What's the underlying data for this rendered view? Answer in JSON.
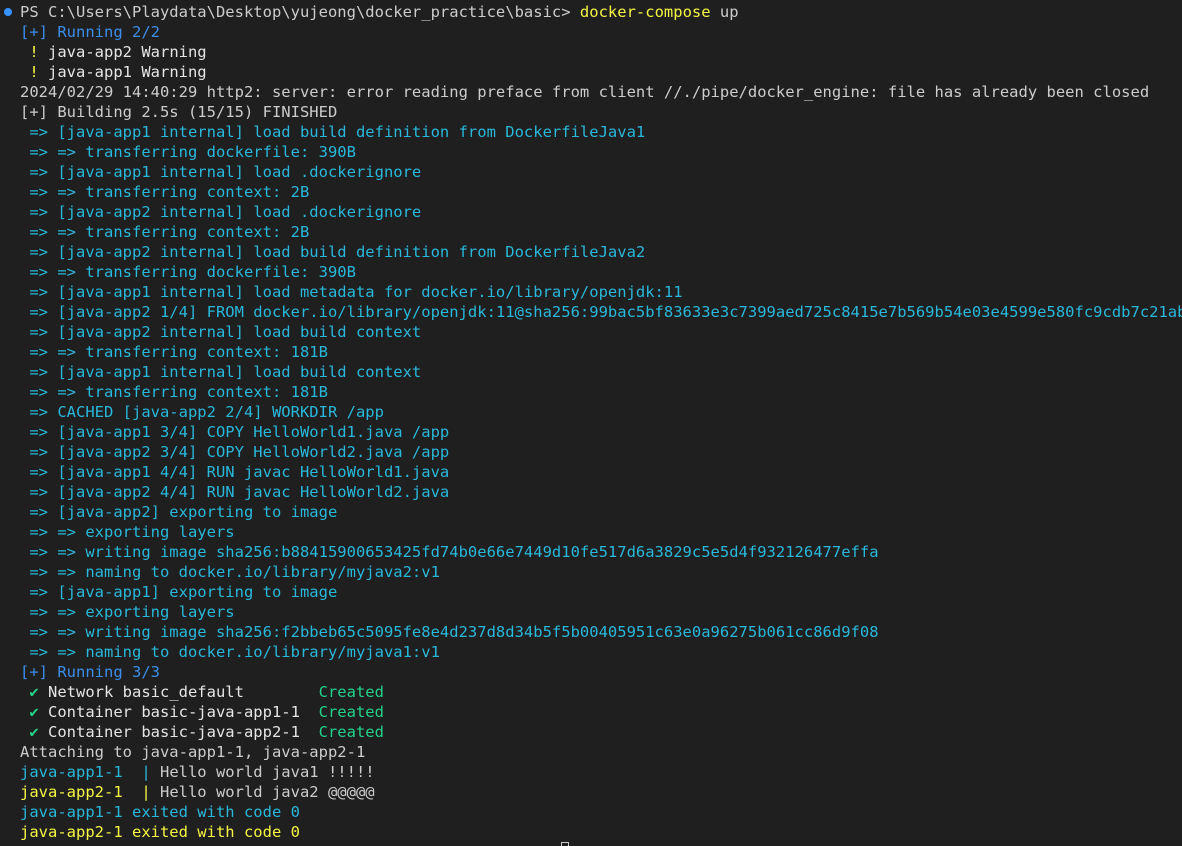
{
  "terminal": {
    "lines": [
      {
        "prompt": true,
        "segments": [
          {
            "text": "PS C:\\Users\\Playdata\\Desktop\\yujeong\\docker_practice\\basic> ",
            "color": "white"
          },
          {
            "text": "docker-compose",
            "color": "yellow"
          },
          {
            "text": " up",
            "color": "white"
          }
        ]
      },
      {
        "segments": [
          {
            "text": "[+] Running 2/2",
            "color": "blue"
          }
        ]
      },
      {
        "segments": [
          {
            "text": " ! ",
            "color": "warn"
          },
          {
            "text": "java-app2 Warning",
            "color": "bright-white"
          }
        ]
      },
      {
        "segments": [
          {
            "text": " ! ",
            "color": "warn"
          },
          {
            "text": "java-app1 Warning",
            "color": "bright-white"
          }
        ]
      },
      {
        "segments": [
          {
            "text": "2024/02/29 14:40:29 http2: server: error reading preface from client //./pipe/docker_engine: file has already been closed",
            "color": "white"
          }
        ]
      },
      {
        "segments": [
          {
            "text": "[+] Building 2.5s (15/15) FINISHED",
            "color": "white"
          }
        ]
      },
      {
        "segments": [
          {
            "text": " => [java-app1 internal] load build definition from DockerfileJava1",
            "color": "cyan"
          }
        ]
      },
      {
        "segments": [
          {
            "text": " => => transferring dockerfile: 390B",
            "color": "cyan"
          }
        ]
      },
      {
        "segments": [
          {
            "text": " => [java-app1 internal] load .dockerignore",
            "color": "cyan"
          }
        ]
      },
      {
        "segments": [
          {
            "text": " => => transferring context: 2B",
            "color": "cyan"
          }
        ]
      },
      {
        "segments": [
          {
            "text": " => [java-app2 internal] load .dockerignore",
            "color": "cyan"
          }
        ]
      },
      {
        "segments": [
          {
            "text": " => => transferring context: 2B",
            "color": "cyan"
          }
        ]
      },
      {
        "segments": [
          {
            "text": " => [java-app2 internal] load build definition from DockerfileJava2",
            "color": "cyan"
          }
        ]
      },
      {
        "segments": [
          {
            "text": " => => transferring dockerfile: 390B",
            "color": "cyan"
          }
        ]
      },
      {
        "segments": [
          {
            "text": " => [java-app1 internal] load metadata for docker.io/library/openjdk:11",
            "color": "cyan"
          }
        ]
      },
      {
        "segments": [
          {
            "text": " => [java-app2 1/4] FROM docker.io/library/openjdk:11@sha256:99bac5bf83633e3c7399aed725c8415e7b569b54e03e4599e580fc9cdb7c21ab",
            "color": "cyan"
          }
        ]
      },
      {
        "segments": [
          {
            "text": " => [java-app2 internal] load build context",
            "color": "cyan"
          }
        ]
      },
      {
        "segments": [
          {
            "text": " => => transferring context: 181B",
            "color": "cyan"
          }
        ]
      },
      {
        "segments": [
          {
            "text": " => [java-app1 internal] load build context",
            "color": "cyan"
          }
        ]
      },
      {
        "segments": [
          {
            "text": " => => transferring context: 181B",
            "color": "cyan"
          }
        ]
      },
      {
        "segments": [
          {
            "text": " => CACHED [java-app2 2/4] WORKDIR /app",
            "color": "cyan"
          }
        ]
      },
      {
        "segments": [
          {
            "text": " => [java-app1 3/4] COPY HelloWorld1.java /app",
            "color": "cyan"
          }
        ]
      },
      {
        "segments": [
          {
            "text": " => [java-app2 3/4] COPY HelloWorld2.java /app",
            "color": "cyan"
          }
        ]
      },
      {
        "segments": [
          {
            "text": " => [java-app1 4/4] RUN javac HelloWorld1.java",
            "color": "cyan"
          }
        ]
      },
      {
        "segments": [
          {
            "text": " => [java-app2 4/4] RUN javac HelloWorld2.java",
            "color": "cyan"
          }
        ]
      },
      {
        "segments": [
          {
            "text": " => [java-app2] exporting to image",
            "color": "cyan"
          }
        ]
      },
      {
        "segments": [
          {
            "text": " => => exporting layers",
            "color": "cyan"
          }
        ]
      },
      {
        "segments": [
          {
            "text": " => => writing image sha256:b88415900653425fd74b0e66e7449d10fe517d6a3829c5e5d4f932126477effa",
            "color": "cyan"
          }
        ]
      },
      {
        "segments": [
          {
            "text": " => => naming to docker.io/library/myjava2:v1",
            "color": "cyan"
          }
        ]
      },
      {
        "segments": [
          {
            "text": " => [java-app1] exporting to image",
            "color": "cyan"
          }
        ]
      },
      {
        "segments": [
          {
            "text": " => => exporting layers",
            "color": "cyan"
          }
        ]
      },
      {
        "segments": [
          {
            "text": " => => writing image sha256:f2bbeb65c5095fe8e4d237d8d34b5f5b00405951c63e0a96275b061cc86d9f08",
            "color": "cyan"
          }
        ]
      },
      {
        "segments": [
          {
            "text": " => => naming to docker.io/library/myjava1:v1",
            "color": "cyan"
          }
        ]
      },
      {
        "segments": [
          {
            "text": "[+] Running 3/3",
            "color": "blue"
          }
        ]
      },
      {
        "segments": [
          {
            "text": " ✔ ",
            "color": "check"
          },
          {
            "text": "Network basic_default        ",
            "color": "bright-white"
          },
          {
            "text": "Created",
            "color": "green"
          }
        ]
      },
      {
        "segments": [
          {
            "text": " ✔ ",
            "color": "check"
          },
          {
            "text": "Container basic-java-app1-1  ",
            "color": "bright-white"
          },
          {
            "text": "Created",
            "color": "green"
          }
        ]
      },
      {
        "segments": [
          {
            "text": " ✔ ",
            "color": "check"
          },
          {
            "text": "Container basic-java-app2-1  ",
            "color": "bright-white"
          },
          {
            "text": "Created",
            "color": "green"
          }
        ]
      },
      {
        "segments": [
          {
            "text": "Attaching to java-app1-1, java-app2-1",
            "color": "white"
          }
        ]
      },
      {
        "segments": [
          {
            "text": "java-app1-1  | ",
            "color": "cyan"
          },
          {
            "text": "Hello world java1 !!!!!",
            "color": "white"
          }
        ]
      },
      {
        "segments": [
          {
            "text": "java-app2-1  | ",
            "color": "yellow"
          },
          {
            "text": "Hello world java2 @@@@@",
            "color": "white"
          }
        ]
      },
      {
        "segments": [
          {
            "text": "java-app1-1 exited with code 0",
            "color": "cyan"
          }
        ]
      },
      {
        "segments": [
          {
            "text": "java-app2-1 exited with code 0",
            "color": "yellow"
          }
        ]
      }
    ]
  }
}
